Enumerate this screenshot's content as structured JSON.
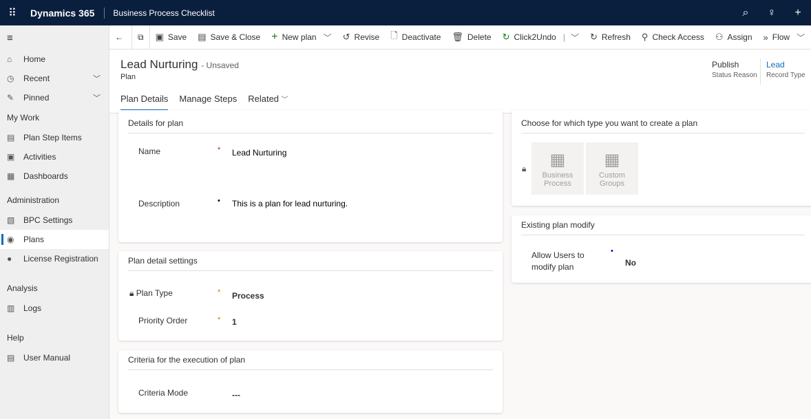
{
  "topbar": {
    "brand": "Dynamics 365",
    "app_title": "Business Process Checklist"
  },
  "sidebar": {
    "items": [
      {
        "label": "Home",
        "icon": "home-icon"
      },
      {
        "label": "Recent",
        "icon": "clock-icon"
      },
      {
        "label": "Pinned",
        "icon": "pin-icon"
      }
    ],
    "sections": [
      {
        "title": "My Work",
        "items": [
          {
            "label": "Plan Step Items"
          },
          {
            "label": "Activities"
          },
          {
            "label": "Dashboards"
          }
        ]
      },
      {
        "title": "Administration",
        "items": [
          {
            "label": "BPC Settings"
          },
          {
            "label": "Plans"
          },
          {
            "label": "License Registration"
          }
        ]
      },
      {
        "title": "Analysis",
        "items": [
          {
            "label": "Logs"
          }
        ]
      },
      {
        "title": "Help",
        "items": [
          {
            "label": "User Manual"
          }
        ]
      }
    ]
  },
  "commands": {
    "save": "Save",
    "save_close": "Save & Close",
    "new_plan": "New plan",
    "revise": "Revise",
    "deactivate": "Deactivate",
    "delete": "Delete",
    "click2undo": "Click2Undo",
    "refresh": "Refresh",
    "check_access": "Check Access",
    "assign": "Assign",
    "flow": "Flow"
  },
  "header": {
    "title": "Lead Nurturing",
    "unsaved": "- Unsaved",
    "entity": "Plan",
    "status_value": "Publish",
    "status_label": "Status Reason",
    "type_value": "Lead",
    "type_label": "Record Type"
  },
  "tabs": [
    "Plan Details",
    "Manage Steps",
    "Related"
  ],
  "details": {
    "title": "Details for plan",
    "name_label": "Name",
    "name_value": "Lead Nurturing",
    "desc_label": "Description",
    "desc_value": "This is a plan for lead nurturing."
  },
  "settings": {
    "title": "Plan detail settings",
    "type_label": "Plan Type",
    "type_value": "Process",
    "priority_label": "Priority Order",
    "priority_value": "1"
  },
  "criteria": {
    "title": "Criteria for the execution of plan",
    "mode_label": "Criteria Mode",
    "mode_value": "---"
  },
  "choose": {
    "title": "Choose for which type you want to create a plan",
    "tile1": "Business Process",
    "tile2": "Custom Groups"
  },
  "modify": {
    "title": "Existing plan modify",
    "label": "Allow Users to modify plan",
    "value": "No"
  },
  "colors": {
    "topbar": "#0a1f3d",
    "accent": "#0f6cbd"
  }
}
